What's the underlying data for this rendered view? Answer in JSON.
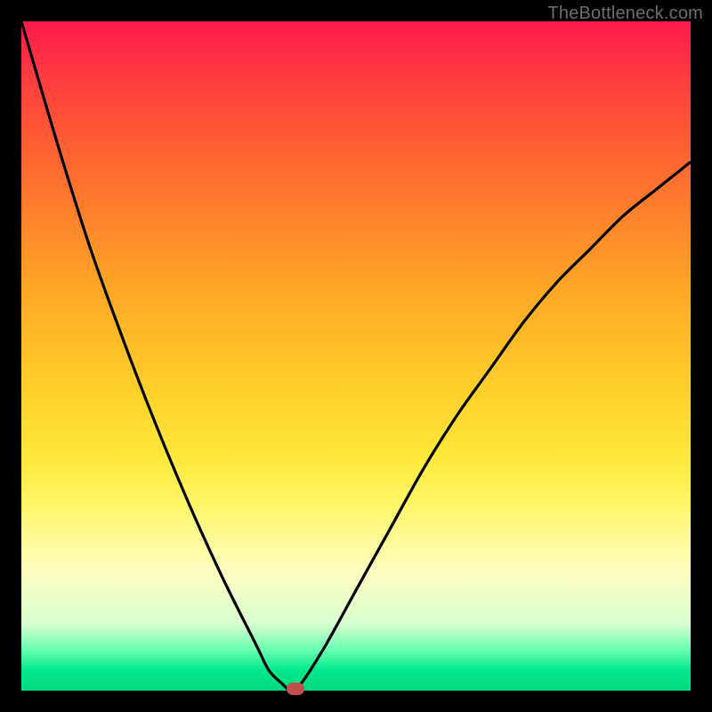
{
  "watermark": "TheBottleneck.com",
  "colors": {
    "frame": "#000000",
    "gradient_top": "#ff1a4d",
    "gradient_bottom": "#00d97f",
    "curve": "#000000",
    "marker": "#c05050"
  },
  "chart_data": {
    "type": "line",
    "title": "",
    "xlabel": "",
    "ylabel": "",
    "xlim": [
      0,
      100
    ],
    "ylim": [
      0,
      100
    ],
    "x": [
      0,
      5,
      10,
      15,
      20,
      25,
      30,
      35,
      37,
      39,
      40,
      41,
      45,
      50,
      55,
      60,
      65,
      70,
      75,
      80,
      85,
      90,
      95,
      100
    ],
    "values": [
      100,
      83,
      67,
      53,
      40,
      28,
      17,
      7,
      3,
      1,
      0,
      0,
      6,
      15,
      24,
      33,
      41,
      48,
      55,
      61,
      66,
      71,
      75,
      79
    ],
    "marker": {
      "x": 41,
      "y": 0
    },
    "legend": []
  }
}
